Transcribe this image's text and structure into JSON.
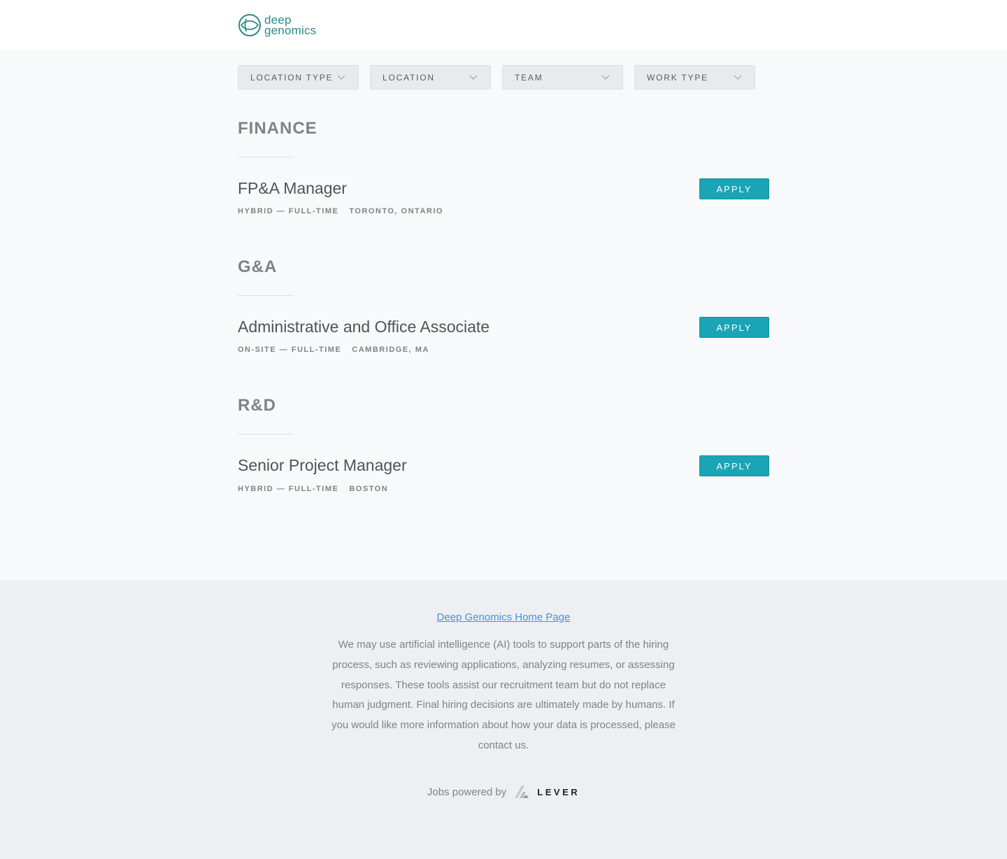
{
  "brand": {
    "logo_line1": "deep",
    "logo_line2": "genomics",
    "accent_color": "#2a8a86"
  },
  "filters": [
    {
      "label": "LOCATION TYPE"
    },
    {
      "label": "LOCATION"
    },
    {
      "label": "TEAM"
    },
    {
      "label": "WORK TYPE"
    }
  ],
  "groups": [
    {
      "title": "FINANCE",
      "postings": [
        {
          "title": "FP&A Manager",
          "work": "HYBRID — FULL-TIME",
          "location": "TORONTO, ONTARIO",
          "apply_label": "APPLY"
        }
      ]
    },
    {
      "title": "G&A",
      "postings": [
        {
          "title": "Administrative and Office Associate",
          "work": "ON-SITE — FULL-TIME",
          "location": "CAMBRIDGE, MA",
          "apply_label": "APPLY"
        }
      ]
    },
    {
      "title": "R&D",
      "postings": [
        {
          "title": "Senior Project Manager",
          "work": "HYBRID — FULL-TIME",
          "location": "BOSTON",
          "apply_label": "APPLY"
        }
      ]
    }
  ],
  "apply_color": "#19a5b6",
  "footer": {
    "home_link": "Deep Genomics Home Page",
    "disclaimer": "We may use artificial intelligence (AI) tools to support parts of the hiring process, such as reviewing applications, analyzing resumes, or assessing responses. These tools assist our recruitment team but do not replace human judgment. Final hiring decisions are ultimately made by humans. If you would like more information about how your data is processed, please contact us.",
    "powered_by": "Jobs powered by",
    "lever": "LEVER"
  }
}
